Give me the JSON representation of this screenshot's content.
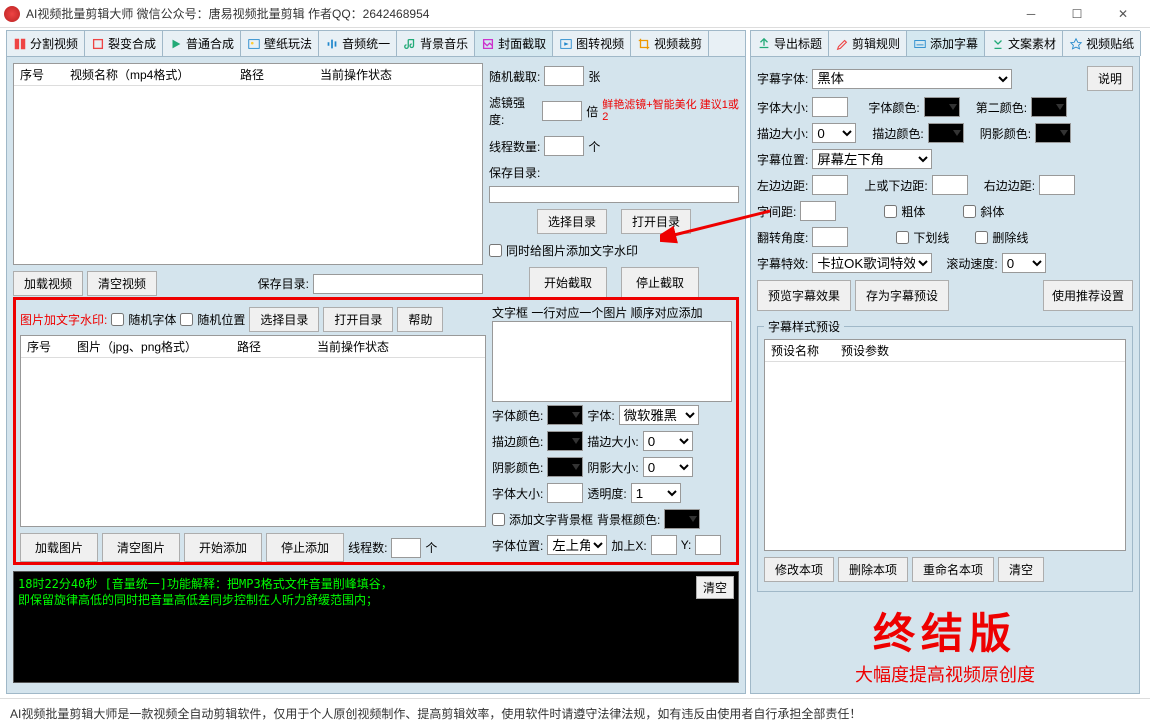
{
  "title": "AI视频批量剪辑大师   微信公众号：唐易视频批量剪辑    作者QQ：2642468954",
  "leftTabs": [
    "分割视频",
    "裂变合成",
    "普通合成",
    "壁纸玩法",
    "音频统一",
    "背景音乐",
    "封面截取",
    "图转视频",
    "视频裁剪"
  ],
  "rightTabs": [
    "导出标题",
    "剪辑规则",
    "添加字幕",
    "文案素材",
    "视频贴纸"
  ],
  "videoTable": {
    "cols": [
      "序号",
      "视频名称（mp4格式）",
      "路径",
      "当前操作状态"
    ]
  },
  "imgTable": {
    "cols": [
      "序号",
      "图片（jpg、png格式）",
      "路径",
      "当前操作状态"
    ]
  },
  "presetTable": {
    "cols": [
      "预设名称",
      "预设参数"
    ]
  },
  "btns": {
    "loadVideo": "加载视频",
    "clearVideo": "清空视频",
    "saveDir": "保存目录:",
    "selectDir": "选择目录",
    "openDir": "打开目录",
    "help": "帮助",
    "loadImg": "加载图片",
    "clearImg": "清空图片",
    "startAdd": "开始添加",
    "stopAdd": "停止添加",
    "startCap": "开始截取",
    "stopCap": "停止截取",
    "preview": "预览字幕效果",
    "savePreset": "存为字幕预设",
    "useRec": "使用推荐设置",
    "modify": "修改本项",
    "delete": "删除本项",
    "rename": "重命名本项",
    "clear": "清空",
    "explain": "说明",
    "clearLog": "清空"
  },
  "labels": {
    "randomCap": "随机截取:",
    "zhang": "张",
    "filterStrength": "滤镜强度:",
    "bei": "倍",
    "filterHint": "鲜艳滤镜+智能美化 建议1或2",
    "threadCount": "线程数量:",
    "ge": "个",
    "saveDir2": "保存目录:",
    "addWatermark": "同时给图片添加文字水印",
    "textBoxHint": "文字框 一行对应一个图片 顺序对应添加",
    "fontColor": "字体颜色:",
    "font": "字体:",
    "fontVal": "微软雅黑",
    "strokeColor": "描边颜色:",
    "strokeSize": "描边大小:",
    "shadowColor": "阴影颜色:",
    "shadowSize": "阴影大小:",
    "fontSize": "字体大小:",
    "opacity": "透明度:",
    "addTextBg": "添加文字背景框",
    "bgColor": "背景框颜色:",
    "fontPos": "字体位置:",
    "fontPosVal": "左上角",
    "addX": "加上X:",
    "y": "Y:",
    "threads": "线程数:",
    "watermarkTitle": "图片加文字水印:",
    "randomFont": "随机字体",
    "randomPos": "随机位置",
    "subFont": "字幕字体:",
    "subFontVal": "黑体",
    "fontSize2": "字体大小:",
    "fontColor2": "字体颜色:",
    "color2": "第二颜色:",
    "strokeSize2": "描边大小:",
    "strokeColor2": "描边颜色:",
    "shadowColor2": "阴影颜色:",
    "subPos": "字幕位置:",
    "subPosVal": "屏幕左下角",
    "leftDist": "左边边距:",
    "topBotDist": "上或下边距:",
    "rightDist": "右边边距:",
    "kerning": "字间距:",
    "bold": "粗体",
    "italic": "斜体",
    "rotate": "翻转角度:",
    "underline": "下划线",
    "strike": "删除线",
    "effect": "字幕特效:",
    "effectVal": "卡拉OK歌词特效",
    "scrollSpeed": "滚动速度:",
    "presetGroup": "字幕样式预设",
    "strokeVal": "0",
    "shadowVal": "0",
    "opacityVal": "1",
    "scrollVal": "0"
  },
  "log": {
    "l1": "18时22分40秒 [音量统一]功能解释：把MP3格式文件音量削峰填谷，",
    "l2": "    即保留旋律高低的同时把音量高低差同步控制在人听力舒缓范围内；"
  },
  "promo": {
    "l1": "终结版",
    "l2": "大幅度提高视频原创度"
  },
  "footer": "AI视频批量剪辑大师是一款视频全自动剪辑软件，仅用于个人原创视频制作、提高剪辑效率，使用软件时请遵守法律法规，如有违反由使用者自行承担全部责任！"
}
